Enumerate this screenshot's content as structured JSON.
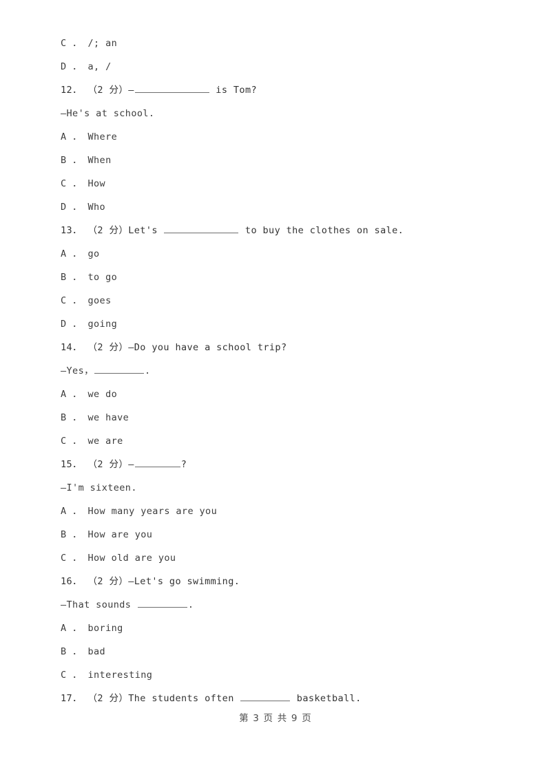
{
  "document": {
    "page_background": "#ffffff",
    "text_color": "#3d3d3d",
    "lines": [
      {
        "id": "opt-11-c",
        "text": "C ． /; an"
      },
      {
        "id": "opt-11-d",
        "text": "D ． a, /"
      },
      {
        "id": "q12-stem",
        "prefix": "12． （2 分）—",
        "blank": "long",
        "suffix": " is Tom?"
      },
      {
        "id": "q12-resp",
        "text": "—He's at school."
      },
      {
        "id": "opt-12-a",
        "text": "A ． Where"
      },
      {
        "id": "opt-12-b",
        "text": "B ． When"
      },
      {
        "id": "opt-12-c",
        "text": "C ． How"
      },
      {
        "id": "opt-12-d",
        "text": "D ． Who"
      },
      {
        "id": "q13-stem",
        "prefix": "13． （2 分）Let's ",
        "blank": "long",
        "suffix": " to buy the clothes on sale."
      },
      {
        "id": "opt-13-a",
        "text": "A ． go"
      },
      {
        "id": "opt-13-b",
        "text": "B ． to go"
      },
      {
        "id": "opt-13-c",
        "text": "C ． goes"
      },
      {
        "id": "opt-13-d",
        "text": "D ． going"
      },
      {
        "id": "q14-stem",
        "text": "14． （2 分）—Do you have a school trip?"
      },
      {
        "id": "q14-resp",
        "prefix": "—Yes，",
        "blank": "short",
        "suffix": "."
      },
      {
        "id": "opt-14-a",
        "text": "A ． we do"
      },
      {
        "id": "opt-14-b",
        "text": "B ． we have"
      },
      {
        "id": "opt-14-c",
        "text": "C ． we are"
      },
      {
        "id": "q15-stem",
        "prefix": "15． （2 分）—",
        "blank": "xshort",
        "suffix": "?"
      },
      {
        "id": "q15-resp",
        "text": "—I'm sixteen."
      },
      {
        "id": "opt-15-a",
        "text": "A ． How many years are you"
      },
      {
        "id": "opt-15-b",
        "text": "B ． How are you"
      },
      {
        "id": "opt-15-c",
        "text": "C ． How old are you"
      },
      {
        "id": "q16-stem",
        "text": "16． （2 分）—Let's go swimming."
      },
      {
        "id": "q16-resp",
        "prefix": "—That sounds ",
        "blank": "short",
        "suffix": "."
      },
      {
        "id": "opt-16-a",
        "text": "A ． boring"
      },
      {
        "id": "opt-16-b",
        "text": "B ． bad"
      },
      {
        "id": "opt-16-c",
        "text": "C ． interesting"
      },
      {
        "id": "q17-stem",
        "prefix": "17． （2 分）The students often ",
        "blank": "short",
        "suffix": " basketball."
      }
    ],
    "footer": {
      "text": "第 3 页 共 9 页",
      "current_page": "3",
      "total_pages": "9"
    }
  }
}
